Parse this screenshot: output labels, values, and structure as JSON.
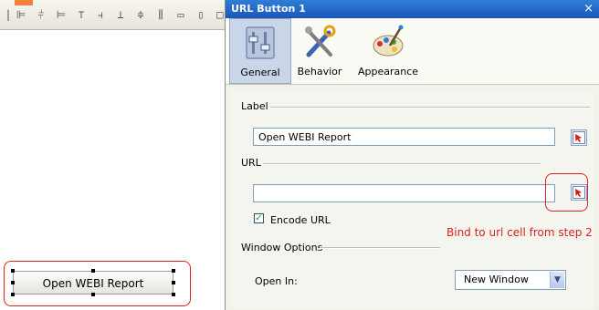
{
  "left_canvas": {
    "url_button_label": "Open WEBI Report"
  },
  "properties_panel": {
    "title": "URL Button 1",
    "close_glyph": "×",
    "tabs": [
      {
        "label": "General",
        "icon": "sliders-icon",
        "selected": true
      },
      {
        "label": "Behavior",
        "icon": "tools-icon",
        "selected": false
      },
      {
        "label": "Appearance",
        "icon": "paint-palette-icon",
        "selected": false
      }
    ],
    "label_section": {
      "heading": "Label",
      "value": "Open WEBI Report"
    },
    "url_section": {
      "heading": "URL",
      "value": ""
    },
    "encode_url": {
      "label": "Encode URL",
      "checked": true,
      "check_glyph": "✓"
    },
    "window_options": {
      "heading": "Window Options",
      "open_in_label": "Open In:",
      "open_in_value": "New Window",
      "arrow_glyph": "▼"
    }
  },
  "annotation": {
    "text": "Bind to url cell from step 2",
    "color": "#d8221c"
  },
  "colors": {
    "titlebar": "#1a56b8",
    "callout_red": "#e0221c",
    "selected_tab": "#c9d6ea"
  }
}
